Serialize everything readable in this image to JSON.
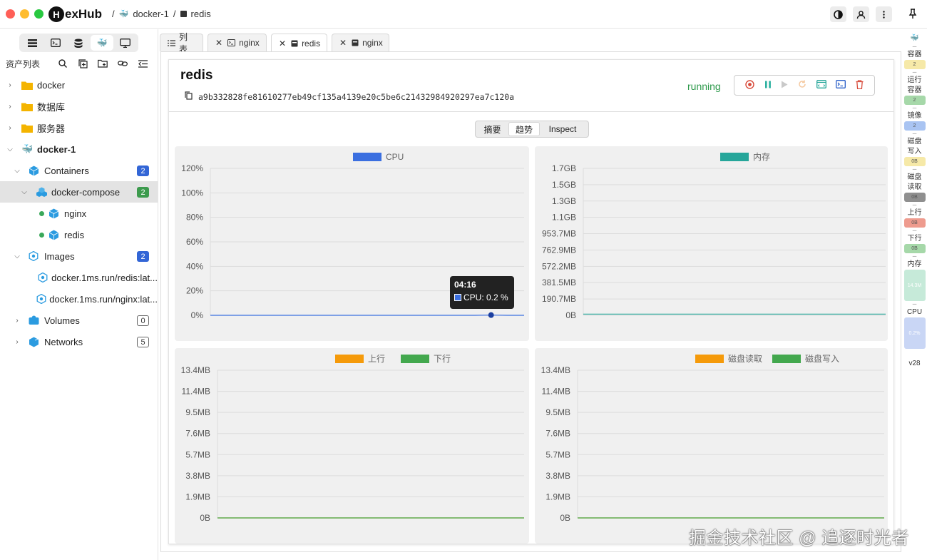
{
  "app": {
    "logo_letter": "H",
    "logo_text": "exHub"
  },
  "breadcrumb": {
    "sep1": "/",
    "item1": "docker-1",
    "sep2": "/",
    "item2": "redis"
  },
  "sidebar": {
    "assets_label": "资产列表",
    "tree": [
      {
        "label": "docker",
        "level": 0,
        "icon": "folder-icon"
      },
      {
        "label": "数据库",
        "level": 0,
        "icon": "folder-icon"
      },
      {
        "label": "服务器",
        "level": 0,
        "icon": "folder-icon"
      },
      {
        "label": "docker-1",
        "level": 0,
        "icon": "docker-icon",
        "bold": true,
        "expanded": true
      },
      {
        "label": "Containers",
        "level": 1,
        "icon": "cube-icon",
        "badge": "2",
        "badge_style": "blue",
        "expanded": true
      },
      {
        "label": "docker-compose",
        "level": 2,
        "icon": "cubes-icon",
        "badge": "2",
        "badge_style": "green",
        "expanded": true,
        "selected": true
      },
      {
        "label": "nginx",
        "level": 3,
        "icon": "cube-icon",
        "running": true
      },
      {
        "label": "redis",
        "level": 3,
        "icon": "cube-icon",
        "running": true
      },
      {
        "label": "Images",
        "level": 1,
        "icon": "image-icon",
        "badge": "2",
        "badge_style": "blue",
        "expanded": true
      },
      {
        "label": "docker.1ms.run/redis:lat...",
        "level": 2,
        "icon": "image-icon"
      },
      {
        "label": "docker.1ms.run/nginx:lat...",
        "level": 2,
        "icon": "image-icon"
      },
      {
        "label": "Volumes",
        "level": 1,
        "icon": "volume-icon",
        "badge": "0",
        "badge_style": "outline"
      },
      {
        "label": "Networks",
        "level": 1,
        "icon": "network-icon",
        "badge": "5",
        "badge_style": "outline"
      }
    ]
  },
  "tabs": [
    {
      "label": "列表",
      "icon": "list-icon",
      "closable": false
    },
    {
      "label": "nginx",
      "icon": "terminal-icon",
      "closable": true
    },
    {
      "label": "redis",
      "icon": "container-icon",
      "closable": true,
      "active": true
    },
    {
      "label": "nginx",
      "icon": "container-icon",
      "closable": true
    }
  ],
  "container": {
    "name": "redis",
    "id": "a9b332828fe81610277eb49cf135a4139e20c5be6c21432984920297ea7c120a",
    "status": "running",
    "status_color": "#2e9a4c"
  },
  "subtabs": [
    "摘要",
    "趋势",
    "Inspect"
  ],
  "subtab_active": "趋势",
  "chart_data": [
    {
      "type": "line",
      "title": "",
      "series": [
        {
          "name": "CPU",
          "color": "#3b6fe0",
          "values": [
            0,
            0,
            0,
            0,
            0,
            0,
            0,
            0,
            0,
            0,
            0,
            0,
            0,
            0,
            0,
            0,
            0,
            0.2,
            0,
            0
          ]
        }
      ],
      "yticks": [
        "120%",
        "100%",
        "80%",
        "60%",
        "40%",
        "20%",
        "0%"
      ],
      "ylim": [
        0,
        120
      ],
      "tooltip": {
        "time": "04:16",
        "text": "CPU: 0.2 %"
      }
    },
    {
      "type": "line",
      "title": "",
      "series": [
        {
          "name": "内存",
          "color": "#26a69a",
          "values": [
            14.3,
            14.3,
            14.3,
            14.3,
            14.3
          ]
        }
      ],
      "yticks": [
        "1.7GB",
        "1.5GB",
        "1.3GB",
        "1.1GB",
        "953.7MB",
        "762.9MB",
        "572.2MB",
        "381.5MB",
        "190.7MB",
        "0B"
      ]
    },
    {
      "type": "line",
      "title": "",
      "series": [
        {
          "name": "上行",
          "color": "#f59a0a",
          "values": [
            0,
            0,
            0
          ]
        },
        {
          "name": "下行",
          "color": "#43a84e",
          "values": [
            0,
            0,
            0
          ]
        }
      ],
      "yticks": [
        "13.4MB",
        "11.4MB",
        "9.5MB",
        "7.6MB",
        "5.7MB",
        "3.8MB",
        "1.9MB",
        "0B"
      ]
    },
    {
      "type": "line",
      "title": "",
      "series": [
        {
          "name": "磁盘读取",
          "color": "#f59a0a",
          "values": [
            0,
            0,
            0
          ]
        },
        {
          "name": "磁盘写入",
          "color": "#43a84e",
          "values": [
            0,
            0,
            0
          ]
        }
      ],
      "yticks": [
        "13.4MB",
        "11.4MB",
        "9.5MB",
        "7.6MB",
        "5.7MB",
        "3.8MB",
        "1.9MB",
        "0B"
      ]
    }
  ],
  "rail": [
    {
      "label": "容器",
      "value": "2",
      "bg": "#f6e9a8"
    },
    {
      "label": "运行容器",
      "value": "2",
      "bg": "#a6d8a9"
    },
    {
      "label": "镜像",
      "value": "2",
      "bg": "#a9c4f2"
    },
    {
      "label": "磁盘写入",
      "value": "0B",
      "bg": "#f6e9a8"
    },
    {
      "label": "磁盘读取",
      "value": "0B",
      "bg": "#8f8f8f"
    },
    {
      "label": "上行",
      "value": "0B",
      "bg": "#ee9b8e"
    },
    {
      "label": "下行",
      "value": "0B",
      "bg": "#a6d8a9"
    },
    {
      "label": "内存",
      "value": "14.3M",
      "bg": "#c6ead9",
      "tall": true
    },
    {
      "label": "CPU",
      "value": "0.2%",
      "bg": "#c9d6f5",
      "tall": true
    }
  ],
  "version": "v28",
  "watermark": "掘金技术社区 @ 追逐时光者"
}
